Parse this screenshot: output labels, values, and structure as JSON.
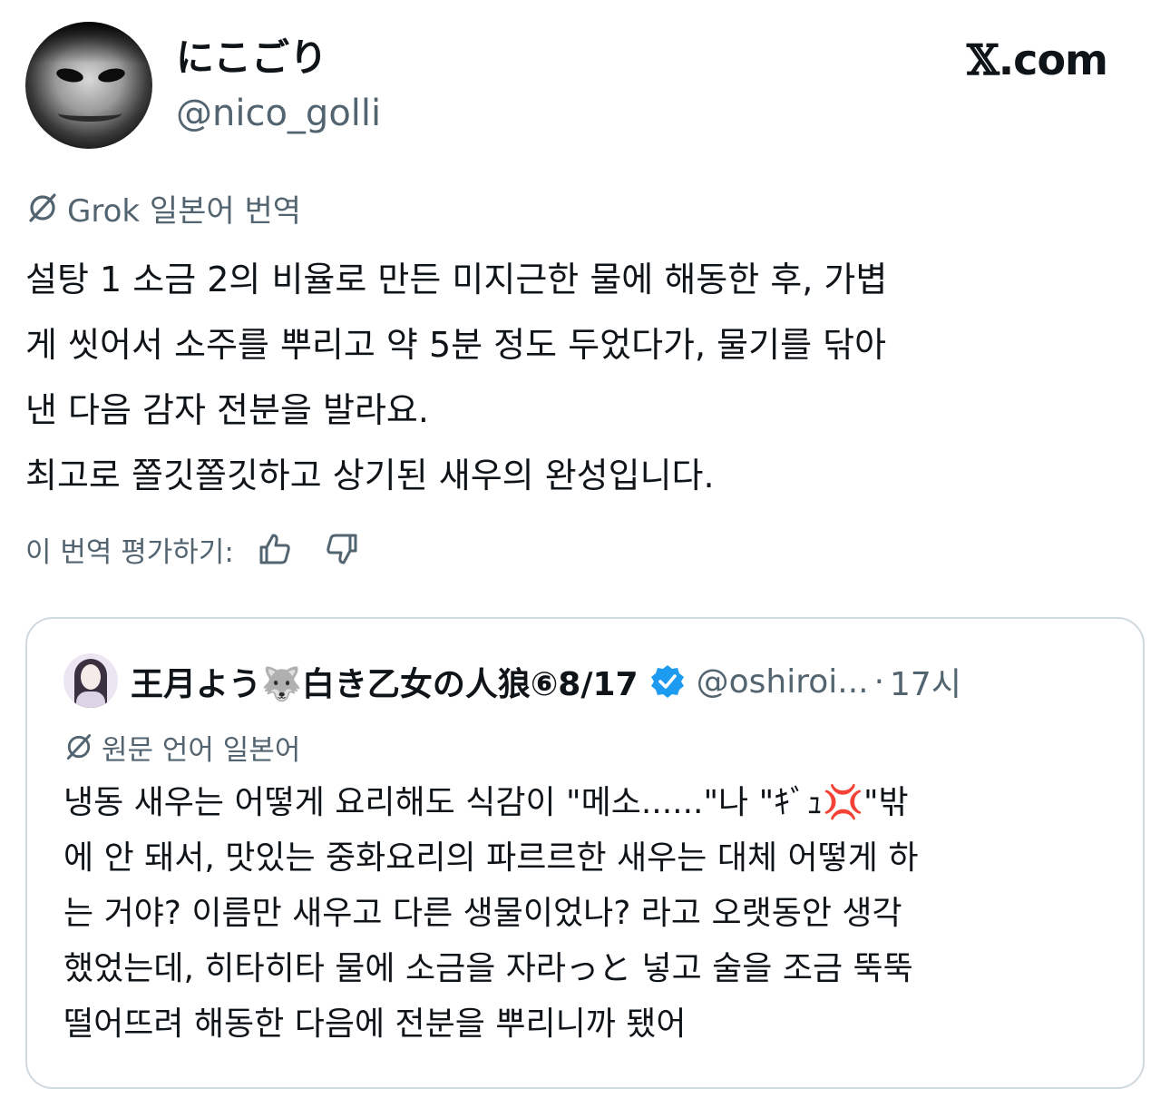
{
  "author": {
    "display_name": "にこごり",
    "handle": "@nico_golli"
  },
  "brand": {
    "mark": "𝕏",
    "domain": ".com"
  },
  "translation_source": {
    "icon": "grok-icon",
    "label": "Grok 일본어 번역"
  },
  "tweet_lines": [
    "설탕 1 소금 2의 비율로 만든 미지근한 물에 해동한 후, 가볍",
    "게 씻어서 소주를 뿌리고 약 5분 정도 두었다가, 물기를 닦아",
    "낸 다음 감자 전분을 발라요.",
    "최고로 쫄깃쫄깃하고 상기된 새우의 완성입니다."
  ],
  "rating": {
    "label": "이 번역 평가하기:",
    "thumbs_up_icon": "thumbs-up-icon",
    "thumbs_down_icon": "thumbs-down-icon"
  },
  "quote": {
    "display_name": "王月よう🐺白き乙女の人狼⑥8/17",
    "verified_icon": "verified-badge-icon",
    "handle": "@oshiroi...",
    "separator": "·",
    "time": "17시",
    "original_language": "원문 언어 일본어",
    "text_lines": [
      "냉동 새우는 어떻게 요리해도 식감이 \"메소......\"나 \"ｷﾞｭ💢\"밖",
      "에 안 돼서, 맛있는 중화요리의 파르르한 새우는 대체 어떻게 하",
      "는 거야? 이름만 새우고 다른 생물이었나? 라고 오랫동안 생각",
      "했었는데, 히타히타 물에 소금을 자라っと 넣고 술을 조금 뚝뚝",
      "떨어뜨려 해동한 다음에 전분을 뿌리니까 됐어"
    ]
  },
  "colors": {
    "text": "#0f1419",
    "secondary": "#536471",
    "border": "#cfd9de",
    "verified": "#1d9bf0"
  }
}
